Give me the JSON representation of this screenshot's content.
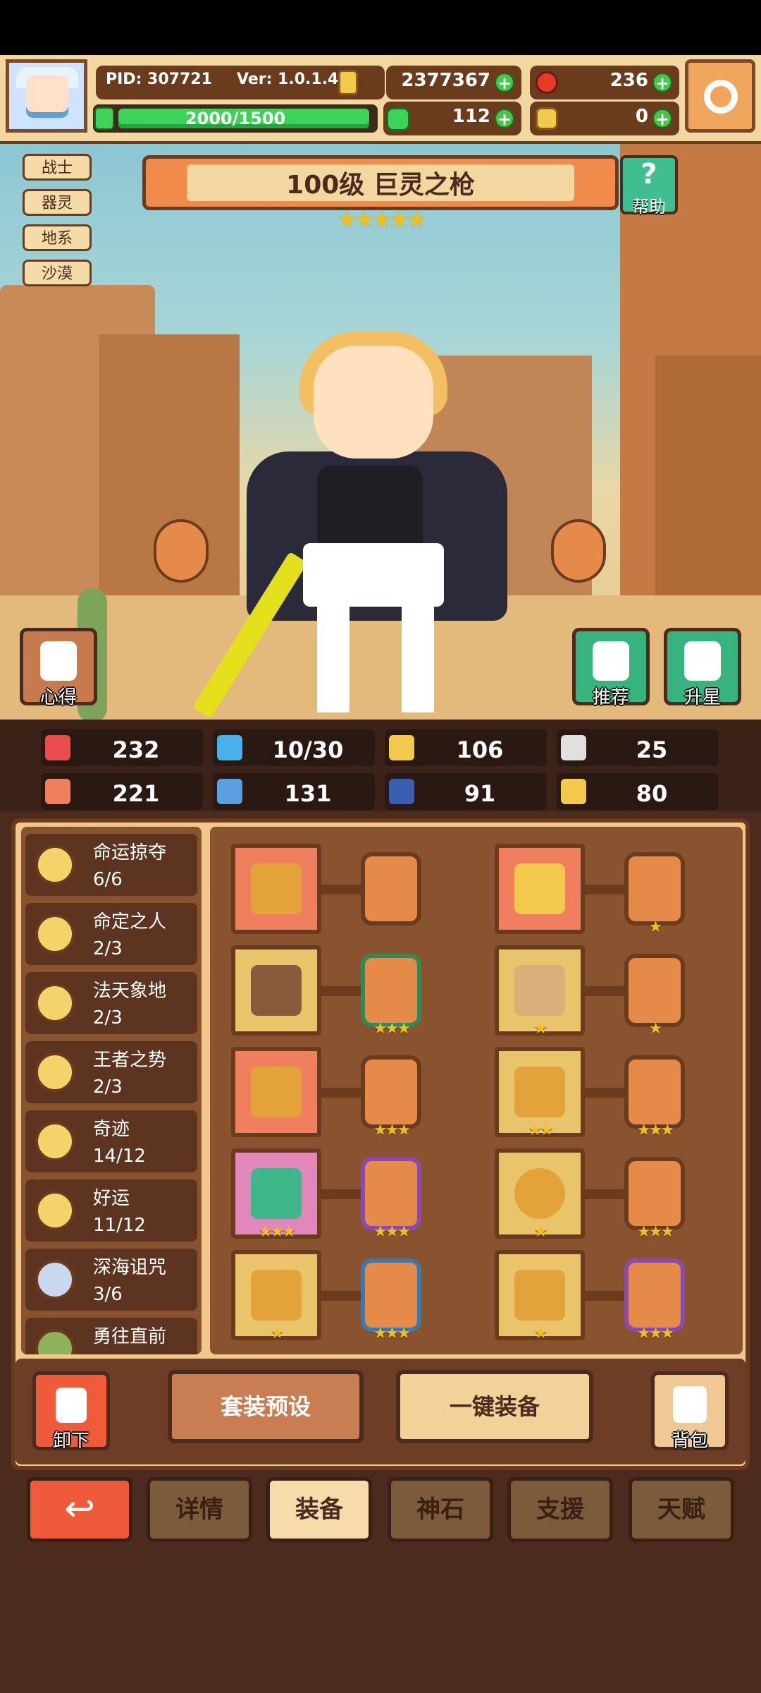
{
  "header": {
    "pid": "PID: 307721",
    "version": "Ver: 1.0.1.4",
    "energy": "2000/1500",
    "gold": "2377367",
    "ruby": "236",
    "clover": "112",
    "item": "0"
  },
  "tags": [
    "战士",
    "器灵",
    "地系",
    "沙漠"
  ],
  "hero": {
    "title": "100级 巨灵之枪",
    "stars": 5,
    "help_label": "帮助",
    "insight_label": "心得",
    "recommend_label": "推荐",
    "starup_label": "升星"
  },
  "stats": [
    "232",
    "10/30",
    "106",
    "25",
    "221",
    "131",
    "91",
    "80"
  ],
  "sets": [
    {
      "name": "命运掠夺",
      "count": "6/6"
    },
    {
      "name": "命定之人",
      "count": "2/3"
    },
    {
      "name": "法天象地",
      "count": "2/3"
    },
    {
      "name": "王者之势",
      "count": "2/3"
    },
    {
      "name": "奇迹",
      "count": "14/12"
    },
    {
      "name": "好运",
      "count": "11/12"
    },
    {
      "name": "深海诅咒",
      "count": "3/6"
    },
    {
      "name": "勇往直前",
      "count": ""
    }
  ],
  "buttons": {
    "unequip": "卸下",
    "preset": "套装预设",
    "auto_equip": "一键装备",
    "bag": "背包"
  },
  "tabs": [
    "详情",
    "装备",
    "神石",
    "支援",
    "天赋"
  ],
  "colors": {
    "accent": "#f18b4c",
    "panel": "#f1c88a",
    "dark": "#4a2b1d"
  }
}
